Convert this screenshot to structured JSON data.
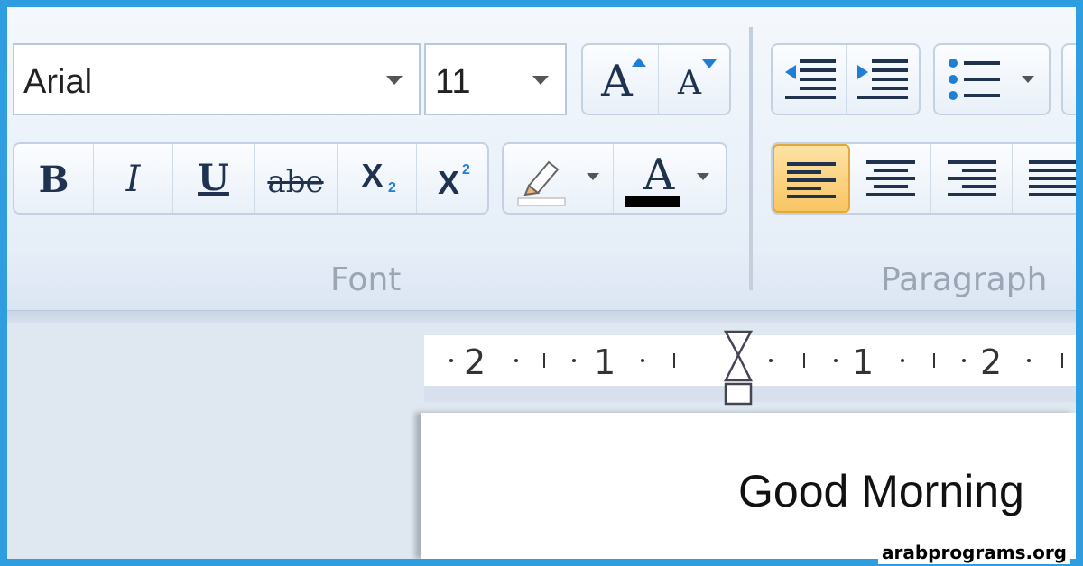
{
  "font_group": {
    "font_name": "Arial",
    "font_size": "11",
    "label": "Font",
    "buttons": [
      {
        "name": "bold",
        "glyph": "B"
      },
      {
        "name": "italic",
        "glyph": "I"
      },
      {
        "name": "underline",
        "glyph": "U"
      },
      {
        "name": "strikethrough",
        "glyph": "abe"
      },
      {
        "name": "subscript",
        "glyph": "X",
        "sub": "2"
      },
      {
        "name": "superscript",
        "glyph": "X",
        "sup": "2"
      }
    ],
    "grow_glyph": "A",
    "shrink_glyph": "A",
    "font_color_glyph": "A",
    "font_color": "#000000",
    "highlight_color": "#ffffff"
  },
  "paragraph_group": {
    "label": "Paragraph",
    "active_alignment": "align-left"
  },
  "ruler": {
    "labels": [
      "2",
      "1",
      "1",
      "2"
    ]
  },
  "document": {
    "text": "Good Morning"
  },
  "watermark": "arabprograms.org",
  "colors": {
    "accent_border": "#2f9ee0",
    "active_button": "#f8c563",
    "icon_blue": "#1f7fd4"
  }
}
